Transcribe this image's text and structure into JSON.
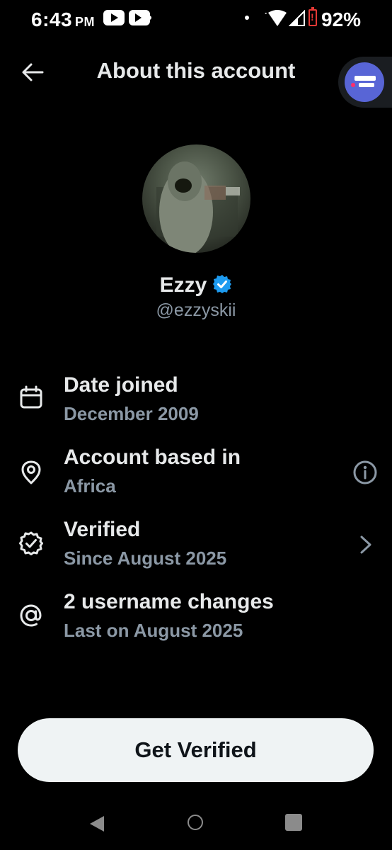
{
  "status_bar": {
    "time": "6:43",
    "ampm": "PM",
    "battery": "92%",
    "icons": [
      "youtube-icon",
      "youtube-tv-icon",
      "notification-dot-icon",
      "wifi-icon",
      "signal-icon",
      "battery-icon"
    ]
  },
  "header": {
    "title": "About this account",
    "back_icon": "back-arrow-icon"
  },
  "floating_button": {
    "icon": "chat-bubble-icon",
    "color": "#5865d6"
  },
  "profile": {
    "name": "Ezzy",
    "handle": "@ezzyskii",
    "verified_color": "#1d9bf0"
  },
  "info_rows": [
    {
      "icon": "calendar-icon",
      "title": "Date joined",
      "subtitle": "December 2009"
    },
    {
      "icon": "location-pin-icon",
      "title": "Account based in",
      "subtitle": "Africa",
      "trailing": "info-icon"
    },
    {
      "icon": "verified-check-icon",
      "title": "Verified",
      "subtitle": "Since August 2025",
      "trailing": "chevron-right-icon"
    },
    {
      "icon": "at-sign-icon",
      "title": "2 username changes",
      "subtitle": "Last on August 2025"
    }
  ],
  "cta": {
    "label": "Get Verified"
  },
  "nav_bar": {
    "icons": [
      "nav-back-icon",
      "nav-home-icon",
      "nav-recents-icon"
    ]
  },
  "colors": {
    "background": "#000000",
    "text_primary": "#e7e9ea",
    "text_secondary": "#8b98a5",
    "button_bg": "#eff3f4"
  }
}
